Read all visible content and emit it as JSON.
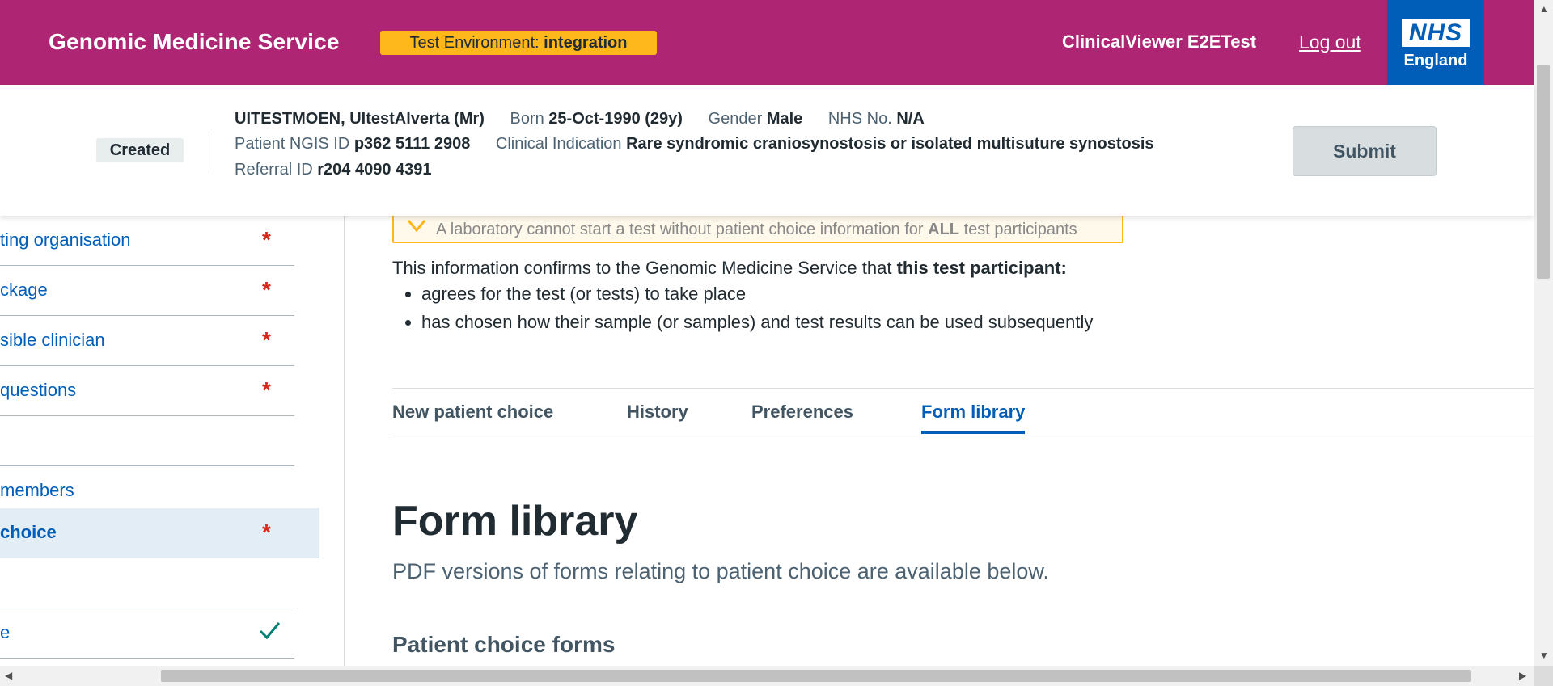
{
  "header": {
    "brand": "Genomic Medicine Service",
    "env_label": "Test Environment:",
    "env_value": "integration",
    "user": "ClinicalViewer E2ETest",
    "logout": "Log out",
    "logo_mark": "NHS",
    "logo_sub": "England",
    "colors": {
      "header_bg": "#ae2573",
      "env_badge": "#ffb81c",
      "nhs_blue": "#005eb8"
    }
  },
  "banner": {
    "status": "Created",
    "name": "UITESTMOEN, UltestAlverta (Mr)",
    "born_label": "Born",
    "born_value": "25-Oct-1990 (29y)",
    "gender_label": "Gender",
    "gender_value": "Male",
    "nhs_label": "NHS No.",
    "nhs_value": "N/A",
    "ngis_label": "Patient NGIS ID",
    "ngis_value": "p362 5111 2908",
    "indication_label": "Clinical Indication",
    "indication_value": "Rare syndromic craniosynostosis or isolated multisuture synostosis",
    "referral_label": "Referral ID",
    "referral_value": "r204 4090 4391",
    "submit": "Submit"
  },
  "sidebar": {
    "items": [
      {
        "label": "ting organisation",
        "marker": "required"
      },
      {
        "label": "ckage",
        "marker": "required"
      },
      {
        "label": "sible clinician",
        "marker": "required"
      },
      {
        "label": "questions",
        "marker": "required"
      },
      {
        "label": "",
        "marker": "none"
      },
      {
        "label": "members",
        "marker": "none"
      },
      {
        "label": "choice",
        "marker": "required",
        "active": true
      },
      {
        "label": "",
        "marker": "none"
      },
      {
        "label": "e",
        "marker": "complete"
      }
    ],
    "required_symbol": "*"
  },
  "main": {
    "warning_a": "A laboratory cannot start a test without patient choice information for",
    "warning_b": "ALL",
    "warning_c": "test participants",
    "intro_a": "This information confirms to the Genomic Medicine Service that",
    "intro_b": "this test participant:",
    "bullets": [
      "agrees for the test (or tests) to take place",
      "has chosen how their sample (or samples) and test results can be used subsequently"
    ],
    "tabs": [
      {
        "label": "New patient choice"
      },
      {
        "label": "History"
      },
      {
        "label": "Preferences"
      },
      {
        "label": "Form library",
        "active": true
      }
    ],
    "title": "Form library",
    "lede": "PDF versions of forms relating to patient choice are available below.",
    "section_heading": "Patient choice forms"
  }
}
